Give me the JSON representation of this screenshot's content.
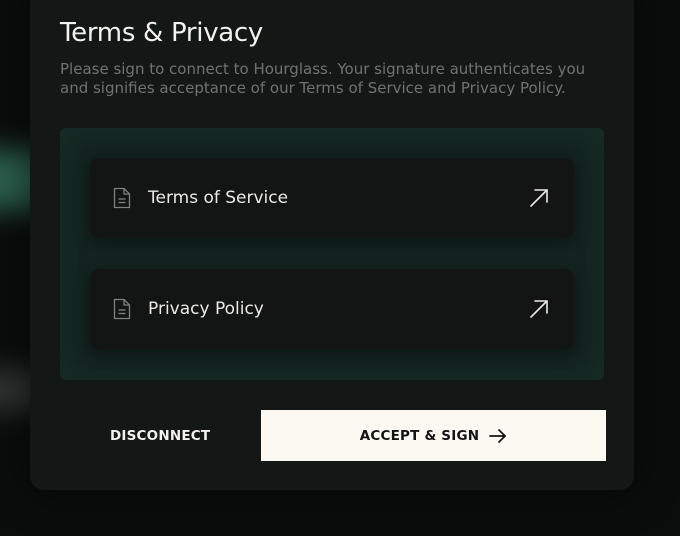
{
  "modal": {
    "title": "Terms & Privacy",
    "description": "Please sign to connect to Hourglass. Your signature authenticates you and signifies acceptance of our Terms of Service and Privacy Policy."
  },
  "documents": [
    {
      "label": "Terms of Service",
      "icon": "document-icon",
      "action_icon": "external-link-icon"
    },
    {
      "label": "Privacy Policy",
      "icon": "document-icon",
      "action_icon": "external-link-icon"
    }
  ],
  "actions": {
    "disconnect_label": "DISCONNECT",
    "accept_label": "ACCEPT & SIGN",
    "accept_icon": "arrow-right-icon"
  },
  "colors": {
    "background": "#0a0d0c",
    "modal": "#131716",
    "panel": "#142420",
    "card": "#121514",
    "primary_button": "#fcf9f2",
    "text_primary": "#f3f2ee",
    "text_muted": "#6d7471"
  }
}
